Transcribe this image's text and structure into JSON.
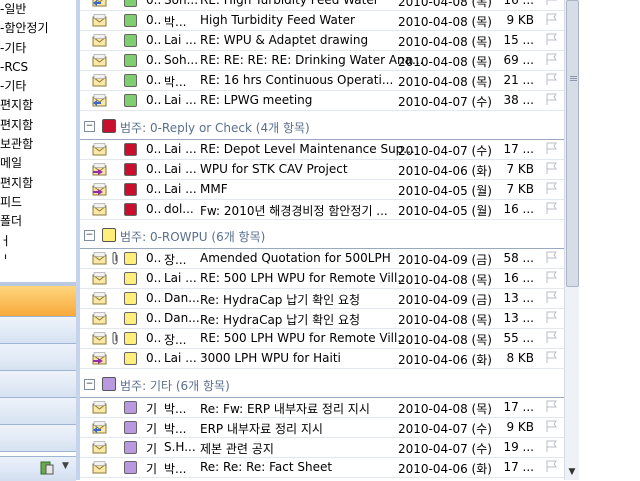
{
  "nav": {
    "folders": [
      {
        "label": "-일반"
      },
      {
        "label": "-함안정기"
      },
      {
        "label": "-기타"
      },
      {
        "label": "-RCS"
      },
      {
        "label": "-기타"
      },
      {
        "label": "편지함"
      },
      {
        "label": "편지함"
      },
      {
        "label": "보관함"
      },
      {
        "label": "메일"
      },
      {
        "label": "편지함"
      },
      {
        "label": "피드"
      },
      {
        "label": "폴더"
      },
      {
        "label": "ㅓ"
      },
      {
        "label": "ㅣ"
      }
    ]
  },
  "colors": {
    "green": "#7fce6f",
    "red": "#c8102e",
    "yellow": "#ffef7a",
    "purple": "#b99ae0"
  },
  "list": {
    "top_rows": [
      {
        "imp": "0..",
        "from": "Soh...",
        "subject": "RE: High Turbidity Feed Water",
        "date": "2010-04-08 (목)",
        "size": "16 ...",
        "cat": "green",
        "icon": "envelope-reply"
      },
      {
        "imp": "0..",
        "from": "박...",
        "subject": "High Turbidity Feed Water",
        "date": "2010-04-08 (목)",
        "size": "9 KB",
        "cat": "green",
        "icon": "envelope"
      },
      {
        "imp": "0..",
        "from": "Lai ...",
        "subject": "RE: WPU & Adaptet drawing",
        "date": "2010-04-08 (목)",
        "size": "15 ...",
        "cat": "green",
        "icon": "envelope"
      },
      {
        "imp": "0..",
        "from": "Soh...",
        "subject": "RE: RE: RE: RE: Drinking Water Ana...",
        "date": "2010-04-08 (목)",
        "size": "69 ...",
        "cat": "green",
        "icon": "envelope"
      },
      {
        "imp": "0..",
        "from": "박...",
        "subject": "RE: 16 hrs Continuous Operati...",
        "date": "2010-04-08 (목)",
        "size": "21 ...",
        "cat": "green",
        "icon": "envelope"
      },
      {
        "imp": "0..",
        "from": "Lai ...",
        "subject": "RE: LPWG meeting",
        "date": "2010-04-07 (수)",
        "size": "38 ...",
        "cat": "green",
        "icon": "envelope-reply"
      }
    ],
    "groups": [
      {
        "label": "범주: 0-Reply or Check (4개 항목)",
        "cat": "red",
        "rows": [
          {
            "imp": "0..",
            "from": "Lai ...",
            "subject": "RE: Depot Level Maintenance Sup...",
            "date": "2010-04-07 (수)",
            "size": "17 ...",
            "cat": "red",
            "icon": "envelope"
          },
          {
            "imp": "0..",
            "from": "Lai ...",
            "subject": "WPU for STK CAV Project",
            "date": "2010-04-06 (화)",
            "size": "7 KB",
            "cat": "red",
            "icon": "envelope-forward"
          },
          {
            "imp": "0..",
            "from": "Lai ...",
            "subject": "MMF",
            "date": "2010-04-05 (월)",
            "size": "7 KB",
            "cat": "red",
            "icon": "envelope-forward"
          },
          {
            "imp": "0..",
            "from": "dol...",
            "subject": "Fw: 2010년 해경경비정 함안정기 ...",
            "date": "2010-04-05 (월)",
            "size": "16 ...",
            "cat": "red",
            "icon": "envelope"
          }
        ]
      },
      {
        "label": "범주: 0-ROWPU (6개 항목)",
        "cat": "yellow",
        "rows": [
          {
            "imp": "0..",
            "from": "장...",
            "subject": "Amended Quotation for 500LPH",
            "date": "2010-04-09 (금)",
            "size": "58 ...",
            "cat": "yellow",
            "icon": "envelope",
            "clip": true
          },
          {
            "imp": "0..",
            "from": "Lai ...",
            "subject": "RE: 500 LPH WPU for Remote Vill...",
            "date": "2010-04-08 (목)",
            "size": "16 ...",
            "cat": "yellow",
            "icon": "envelope"
          },
          {
            "imp": "0..",
            "from": "Dan...",
            "subject": "Re: HydraCap 납기 확인 요청",
            "date": "2010-04-09 (금)",
            "size": "13 ...",
            "cat": "yellow",
            "icon": "envelope"
          },
          {
            "imp": "0..",
            "from": "Dan...",
            "subject": "Re: HydraCap 납기 확인 요청",
            "date": "2010-04-08 (목)",
            "size": "13 ...",
            "cat": "yellow",
            "icon": "envelope"
          },
          {
            "imp": "0..",
            "from": "장...",
            "subject": "RE: 500 LPH WPU for Remote Vill...",
            "date": "2010-04-08 (목)",
            "size": "55 ...",
            "cat": "yellow",
            "icon": "envelope",
            "clip": true
          },
          {
            "imp": "0..",
            "from": "Lai ...",
            "subject": "3000 LPH WPU for Haiti",
            "date": "2010-04-06 (화)",
            "size": "8 KB",
            "cat": "yellow",
            "icon": "envelope-forward"
          }
        ]
      },
      {
        "label": "범주: 기타 (6개 항목)",
        "cat": "purple",
        "rows": [
          {
            "imp": "기",
            "from": "박...",
            "subject": "Re: Fw: ERP 내부자료 정리 지시",
            "date": "2010-04-08 (목)",
            "size": "17 ...",
            "cat": "purple",
            "icon": "envelope"
          },
          {
            "imp": "기",
            "from": "박...",
            "subject": "ERP 내부자료 정리 지시",
            "date": "2010-04-07 (수)",
            "size": "9 KB",
            "cat": "purple",
            "icon": "envelope-reply"
          },
          {
            "imp": "기",
            "from": "S.H...",
            "subject": "제본 관련 공지",
            "date": "2010-04-07 (수)",
            "size": "19 ...",
            "cat": "purple",
            "icon": "envelope"
          },
          {
            "imp": "기",
            "from": "박...",
            "subject": "Re: Re: Re: Fact Sheet",
            "date": "2010-04-06 (화)",
            "size": "17 ...",
            "cat": "purple",
            "icon": "envelope"
          }
        ]
      }
    ]
  }
}
